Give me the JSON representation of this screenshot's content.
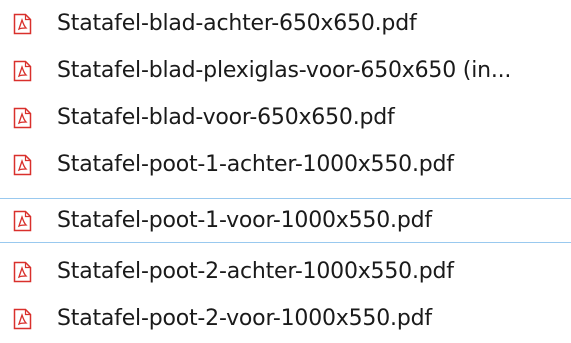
{
  "files": [
    {
      "name": "Statafel-blad-achter-650x650.pdf",
      "icon": "pdf-file-icon",
      "selected": false
    },
    {
      "name": "Statafel-blad-plexiglas-voor-650x650 (in...",
      "icon": "pdf-file-icon",
      "selected": false
    },
    {
      "name": "Statafel-blad-voor-650x650.pdf",
      "icon": "pdf-file-icon",
      "selected": false
    },
    {
      "name": "Statafel-poot-1-achter-1000x550.pdf",
      "icon": "pdf-file-icon",
      "selected": false
    },
    {
      "name": "Statafel-poot-1-voor-1000x550.pdf",
      "icon": "pdf-file-icon",
      "selected": true
    },
    {
      "name": "Statafel-poot-2-achter-1000x550.pdf",
      "icon": "pdf-file-icon",
      "selected": false
    },
    {
      "name": "Statafel-poot-2-voor-1000x550.pdf",
      "icon": "pdf-file-icon",
      "selected": false
    }
  ],
  "colors": {
    "pdf_icon": "#d9302c",
    "selection_border": "#99c9ef",
    "text": "#1a1a1a"
  }
}
